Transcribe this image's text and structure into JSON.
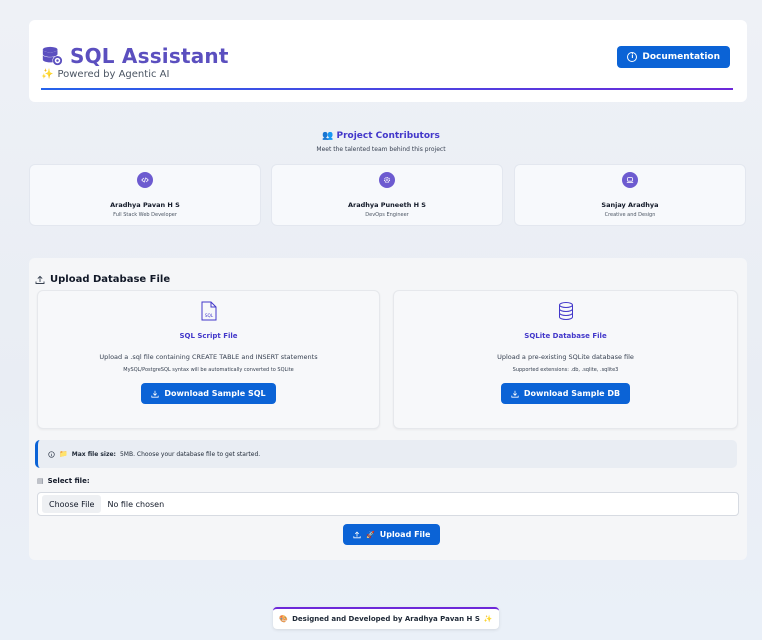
{
  "header": {
    "title": "SQL Assistant",
    "subtitle": "Powered by Agentic AI",
    "subtitle_icon": "sparkles-icon",
    "documentation_label": "Documentation"
  },
  "contributors": {
    "title": "Project Contributors",
    "subtitle": "Meet the talented team behind this project",
    "people": [
      {
        "name": "Aradhya Pavan H S",
        "role": "Full Stack Web Developer",
        "icon": "code-icon"
      },
      {
        "name": "Aradhya Puneeth H S",
        "role": "DevOps Engineer",
        "icon": "gear-icon"
      },
      {
        "name": "Sanjay Aradhya",
        "role": "Creative and Design",
        "icon": "laptop-icon"
      }
    ]
  },
  "upload": {
    "title": "Upload Database File",
    "sql_option": {
      "title": "SQL Script File",
      "description": "Upload a .sql file containing CREATE TABLE and INSERT statements",
      "note": "MySQL/PostgreSQL syntax will be automatically converted to SQLite",
      "button": "Download Sample SQL",
      "icon_text": "SQL"
    },
    "db_option": {
      "title": "SQLite Database File",
      "description": "Upload a pre-existing SQLite database file",
      "note": "Supported extensions: .db, .sqlite, .sqlite3",
      "button": "Download Sample DB"
    },
    "info_bold": "Max file size:",
    "info_text": "5MB. Choose your database file to get started.",
    "select_label": "Select file:",
    "choose_file": "Choose File",
    "no_file": "No file chosen",
    "upload_button": "Upload File"
  },
  "footer": {
    "text": "Designed and Developed by Aradhya Pavan H S"
  },
  "colors": {
    "primary": "#0b63d6",
    "accent": "#5b4fbf",
    "badge": "#6d5bd0"
  }
}
